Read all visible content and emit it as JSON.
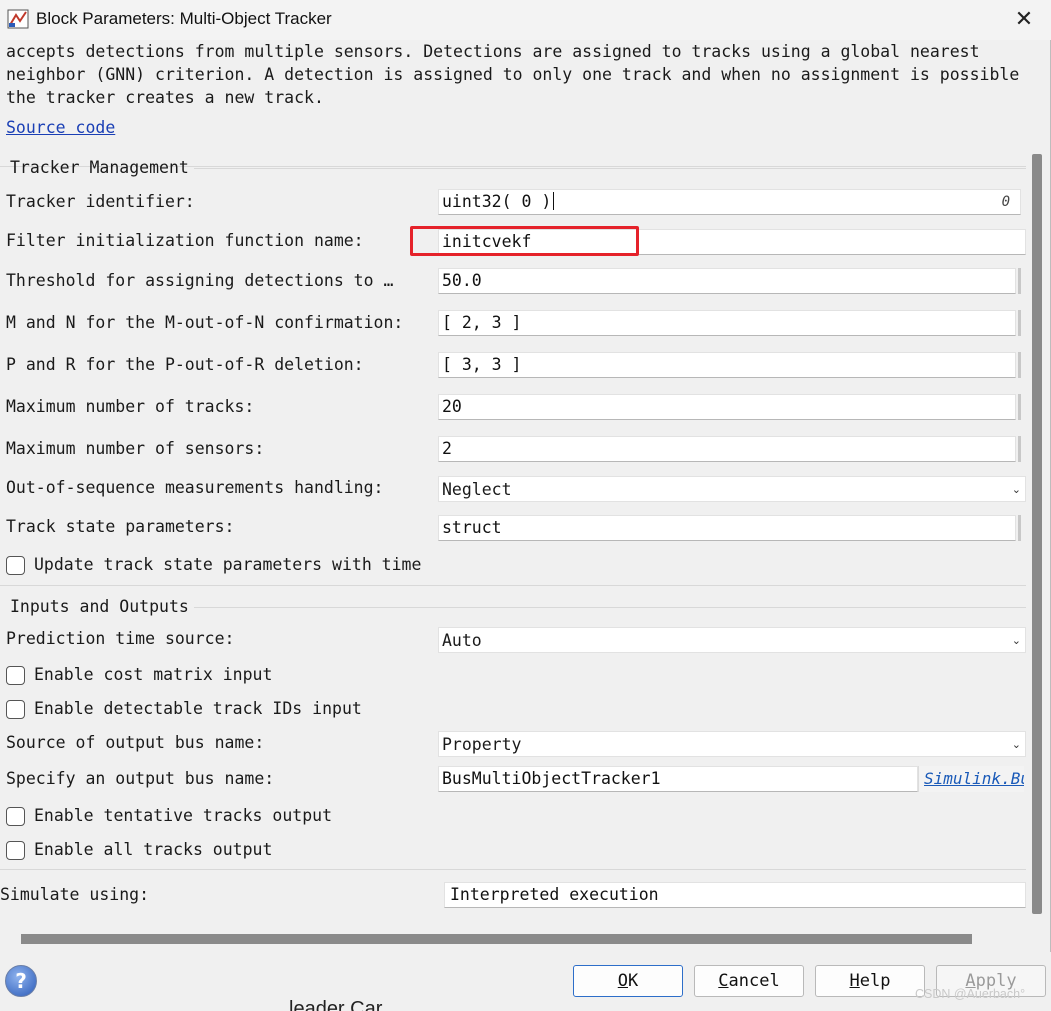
{
  "window": {
    "title": "Block Parameters: Multi-Object Tracker",
    "close_glyph": "✕",
    "app_icon": "simulink-block-icon"
  },
  "description": {
    "lines": [
      "accepts detections from multiple sensors. Detections are assigned to tracks using a global nearest",
      "neighbor (GNN) criterion. A detection is assigned to only one track and when no assignment is possible",
      "the tracker creates a new track."
    ],
    "source_link": "Source code"
  },
  "tracker_management": {
    "heading": "Tracker Management",
    "tracker_identifier": {
      "label": "Tracker identifier:",
      "value": "uint32( 0 )",
      "badge": "0"
    },
    "filter_init": {
      "label": "Filter initialization function name:",
      "value": "initcvekf"
    },
    "threshold": {
      "label": "Threshold for assigning detections to …",
      "value": "50.0"
    },
    "m_n": {
      "label": "M and N for the M-out-of-N confirmation:",
      "value": "[ 2, 3 ]"
    },
    "p_r": {
      "label": "P and R for the P-out-of-R deletion:",
      "value": "[ 3, 3 ]"
    },
    "max_tracks": {
      "label": "Maximum number of tracks:",
      "value": "20"
    },
    "max_sensors": {
      "label": "Maximum number of sensors:",
      "value": "2"
    },
    "oosm": {
      "label": "Out-of-sequence measurements handling:",
      "value": "Neglect"
    },
    "track_state": {
      "label": "Track state parameters:",
      "value": "struct"
    },
    "update_track_state": {
      "label": "Update track state parameters with time",
      "checked": false
    }
  },
  "inputs_outputs": {
    "heading": "Inputs and Outputs",
    "prediction_time": {
      "label": "Prediction time source:",
      "value": "Auto"
    },
    "cost_matrix": {
      "label": "Enable cost matrix input",
      "checked": false
    },
    "detectable_ids": {
      "label": "Enable detectable track IDs input",
      "checked": false
    },
    "bus_source": {
      "label": "Source of output bus name:",
      "value": "Property"
    },
    "bus_name": {
      "label": "Specify an output bus name:",
      "value": "BusMultiObjectTracker1",
      "link": "Simulink.Bus"
    },
    "tentative_tracks": {
      "label": "Enable tentative tracks output",
      "checked": false
    },
    "all_tracks": {
      "label": "Enable all tracks output",
      "checked": false
    }
  },
  "simulate": {
    "label": "Simulate using:",
    "value": "Interpreted execution"
  },
  "buttons": {
    "ok": {
      "pre": "",
      "u": "O",
      "post": "K"
    },
    "cancel": {
      "pre": "",
      "u": "C",
      "post": "ancel"
    },
    "help": {
      "pre": "",
      "u": "H",
      "post": "elp"
    },
    "apply": {
      "pre": "",
      "u": "A",
      "post": "pply"
    }
  },
  "help_icon_glyph": "?",
  "chevron_glyph": "⌄",
  "highlight_color": "#e5222a",
  "background_text": "leader Car",
  "watermark": "CSDN @Auerbach°"
}
